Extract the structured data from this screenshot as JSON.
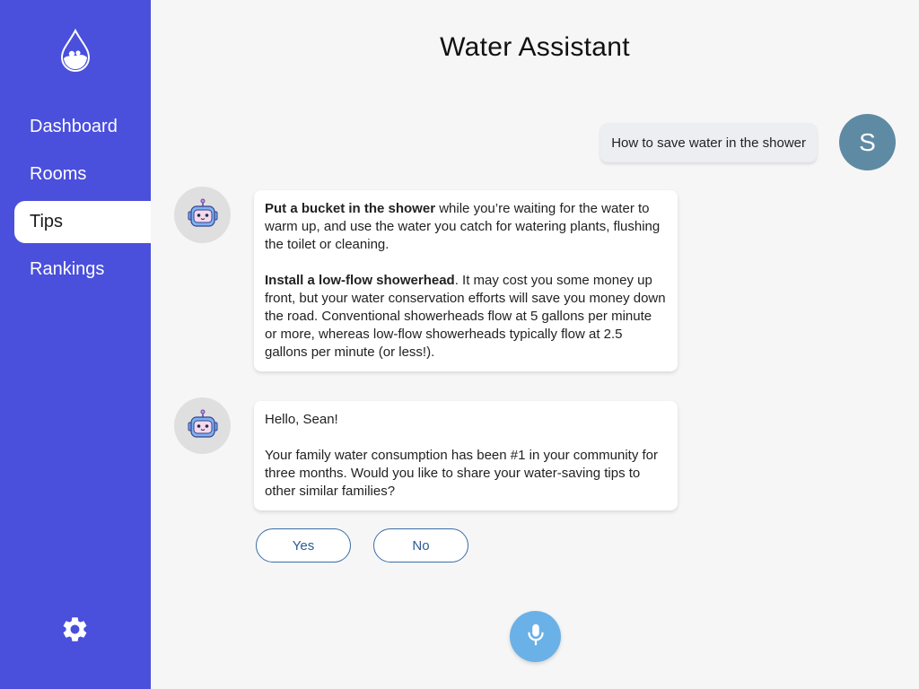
{
  "app": {
    "title": "Water Assistant"
  },
  "sidebar": {
    "logo_icon": "water-drop-icon",
    "items": [
      {
        "label": "Dashboard",
        "active": false
      },
      {
        "label": "Rooms",
        "active": false
      },
      {
        "label": "Tips",
        "active": true
      },
      {
        "label": "Rankings",
        "active": false
      }
    ],
    "settings_icon": "gear-icon"
  },
  "chat": {
    "user_message": "How to save water in the shower",
    "user_initial": "S",
    "bot_message_1": {
      "p1_bold": "Put a bucket in the shower",
      "p1_rest": " while you’re waiting for the water to warm up, and use the water you catch for watering plants, flushing the toilet or cleaning.",
      "p2_bold": "Install a low-flow showerhead",
      "p2_rest": ". It may cost you some money up front, but your water conservation efforts will save you money down the road. Conventional showerheads flow at 5 gallons per minute or more, whereas low-flow showerheads typically flow at 2.5 gallons per minute (or less!)."
    },
    "bot_message_2": {
      "greeting": "Hello, Sean!",
      "body": "Your family water consumption has been #1 in your community for three months. Would you like to share your water-saving tips to other similar families?"
    },
    "quick_replies": {
      "yes": "Yes",
      "no": "No"
    }
  },
  "mic_icon": "microphone-icon",
  "colors": {
    "sidebar": "#4a4fdc",
    "background": "#f6f6f6",
    "user_avatar": "#5f8aa3",
    "mic": "#6ab1e8",
    "pill_border": "#3a6ea8"
  }
}
